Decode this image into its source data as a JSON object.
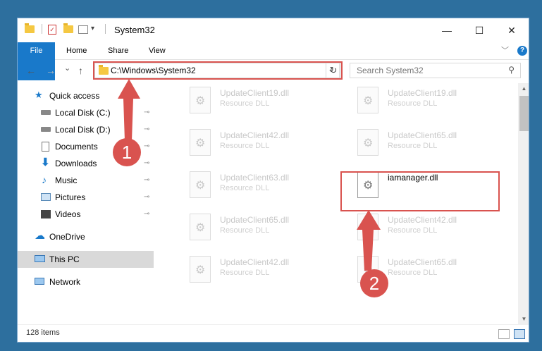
{
  "window": {
    "title": "System32"
  },
  "titlebar_buttons": {
    "minimize": "—",
    "maximize": "☐",
    "close": "✕"
  },
  "ribbon": {
    "tabs": [
      "File",
      "Home",
      "Share",
      "View"
    ],
    "chevron": "﹀",
    "help": "?"
  },
  "nav": {
    "back": "←",
    "forward": "→",
    "recent": "⌄",
    "up": "↑"
  },
  "address": {
    "path": "C:\\Windows\\System32",
    "dropdown": "⌄",
    "refresh": "↻"
  },
  "search": {
    "placeholder": "Search System32"
  },
  "sidebar": {
    "items": [
      {
        "label": "Quick access",
        "icon": "star-icon"
      },
      {
        "label": "Local Disk (C:)",
        "icon": "drive-icon",
        "pinned": true
      },
      {
        "label": "Local Disk (D:)",
        "icon": "drive-icon",
        "pinned": true
      },
      {
        "label": "Documents",
        "icon": "documents-icon",
        "pinned": true
      },
      {
        "label": "Downloads",
        "icon": "download-icon",
        "pinned": true
      },
      {
        "label": "Music",
        "icon": "music-icon",
        "pinned": true
      },
      {
        "label": "Pictures",
        "icon": "pictures-icon",
        "pinned": true
      },
      {
        "label": "Videos",
        "icon": "videos-icon",
        "pinned": true
      },
      {
        "label": "OneDrive",
        "icon": "cloud-icon"
      },
      {
        "label": "This PC",
        "icon": "computer-icon",
        "selected": true
      },
      {
        "label": "Network",
        "icon": "network-icon"
      }
    ],
    "pin_glyph": "📌"
  },
  "files": [
    {
      "name": "UpdateClient19.dll",
      "type": "Resource DLL"
    },
    {
      "name": "UpdateClient19.dll",
      "type": "Resource DLL"
    },
    {
      "name": "UpdateClient42.dll",
      "type": "Resource DLL"
    },
    {
      "name": "UpdateClient65.dll",
      "type": "Resource DLL"
    },
    {
      "name": "UpdateClient63.dll",
      "type": "Resource DLL"
    },
    {
      "name": "iamanager.dll",
      "type": "",
      "highlighted": true
    },
    {
      "name": "UpdateClient65.dll",
      "type": "Resource DLL"
    },
    {
      "name": "UpdateClient42.dll",
      "type": "Resource DLL"
    },
    {
      "name": "UpdateClient42.dll",
      "type": "Resource DLL"
    },
    {
      "name": "UpdateClient65.dll",
      "type": "Resource DLL"
    }
  ],
  "status": {
    "count": "128 items"
  },
  "callouts": [
    "1",
    "2"
  ],
  "colors": {
    "accent": "#1979ca",
    "highlight": "#d9534f",
    "background": "#2d6f9e"
  }
}
